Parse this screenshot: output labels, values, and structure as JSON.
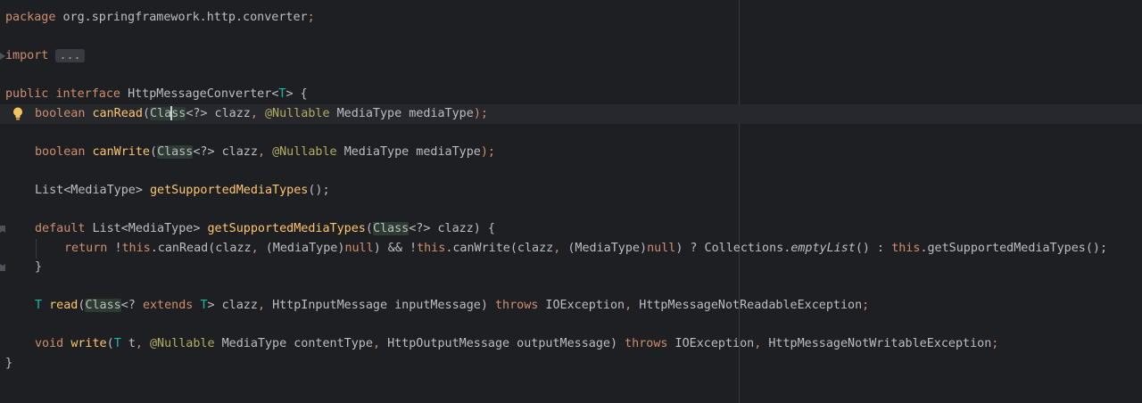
{
  "editor": {
    "lines": {
      "l1": [
        "package",
        "org.springframework.http.converter",
        ";"
      ],
      "l3": [
        "import",
        "..."
      ],
      "l5": [
        "public",
        "interface",
        "HttpMessageConverter",
        "<",
        "T",
        "> {"
      ],
      "l6": [
        "boolean",
        "canRead",
        "(",
        "Cla",
        "ss",
        "<?> clazz",
        ",",
        "@Nullable",
        "MediaType mediaType",
        ");"
      ],
      "l8": [
        "boolean",
        "canWrite",
        "(",
        "Class",
        "<?> clazz",
        ",",
        "@Nullable",
        "MediaType mediaType",
        ");"
      ],
      "l10": [
        "List<MediaType>",
        "getSupportedMediaTypes",
        "();"
      ],
      "l12": [
        "default",
        "List<MediaType>",
        "getSupportedMediaTypes",
        "(",
        "Class",
        "<?> clazz) {"
      ],
      "l13": [
        "return",
        "!",
        "this",
        ".canRead(clazz",
        ",",
        "(MediaType)",
        "null",
        ") && !",
        "this",
        ".canWrite(clazz",
        ",",
        "(MediaType)",
        "null",
        ") ? Collections.",
        "emptyList",
        "() : ",
        "this",
        ".getSupportedMediaTypes();"
      ],
      "l14": [
        "}"
      ],
      "l16": [
        "T",
        "read",
        "(",
        "Class",
        "<?",
        "extends",
        "T",
        "> clazz",
        ",",
        "HttpInputMessage inputMessage)",
        "throws",
        "IOException",
        ",",
        "HttpMessageNotReadableException",
        ";"
      ],
      "l18": [
        "void",
        "write",
        "(",
        "T",
        "t",
        ",",
        "@Nullable",
        "MediaType contentType",
        ",",
        "HttpOutputMessage outputMessage)",
        "throws",
        "IOException",
        ",",
        "HttpMessageNotWritableException",
        ";"
      ],
      "l19": [
        "}"
      ]
    },
    "colors": {
      "background": "#1e1f22",
      "keyword": "#cf8e6d",
      "method_declaration": "#ffc66d",
      "annotation": "#b3ae60",
      "type_parameter": "#16baac",
      "text": "#bcbec4"
    },
    "icons": {
      "gutter": "lightbulb-icon",
      "fold": "fold-marker-icon"
    }
  }
}
